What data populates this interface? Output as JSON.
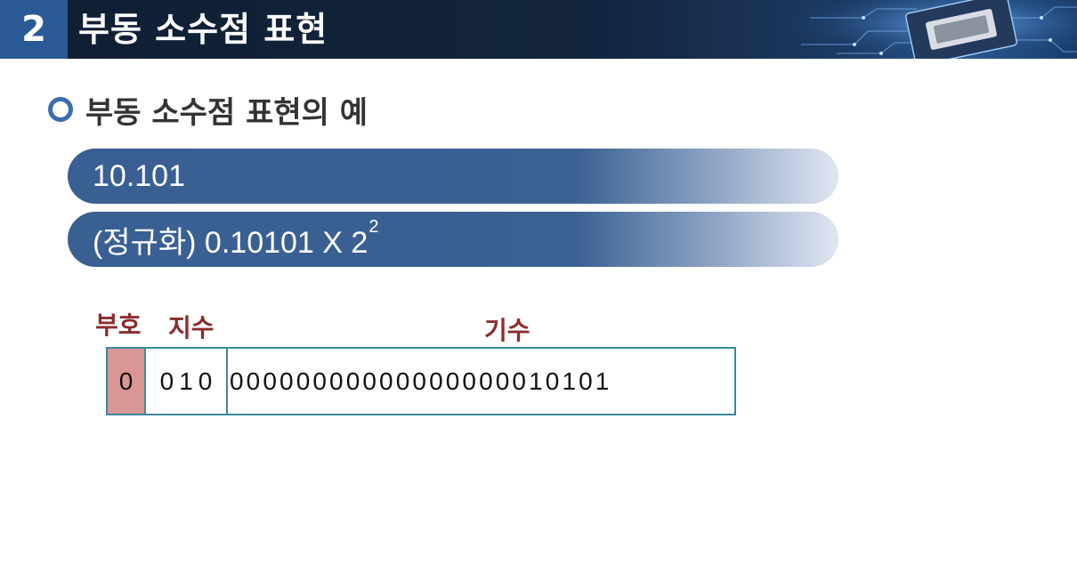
{
  "header": {
    "section_number": "2",
    "title": "부동 소수점 표현"
  },
  "subheading": {
    "title": "부동 소수점 표현의 예"
  },
  "examples": {
    "binary_value": "10.101",
    "normalized_prefix": "(정규화) 0.10101 X 2",
    "normalized_exponent": "2"
  },
  "bit_layout": {
    "sign_label": "부호",
    "exponent_label": "지수",
    "mantissa_label": "기수",
    "sign_bits": "0",
    "exponent_bits": "010",
    "mantissa_bits": "00000000000000000010101"
  },
  "colors": {
    "header_bg": "#13243d",
    "section_number_bg": "#2a5a96",
    "pill_bg": "#395f93",
    "label_color": "#8b2c2c",
    "sign_cell_bg": "#d99694",
    "box_border": "#3a8a9c"
  }
}
